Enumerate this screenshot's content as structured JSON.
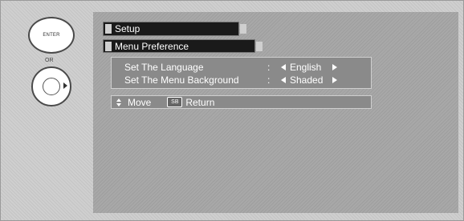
{
  "remote": {
    "enter_label": "ENTER",
    "or_label": "OR"
  },
  "menu": {
    "title": "Setup",
    "submenu_title": "Menu Preference",
    "options": [
      {
        "label": "Set The Language",
        "value": "English"
      },
      {
        "label": "Set The Menu Background",
        "value": "Shaded"
      }
    ],
    "separator": ":"
  },
  "help": {
    "move_label": "Move",
    "key_label": "SB",
    "return_label": "Return"
  }
}
